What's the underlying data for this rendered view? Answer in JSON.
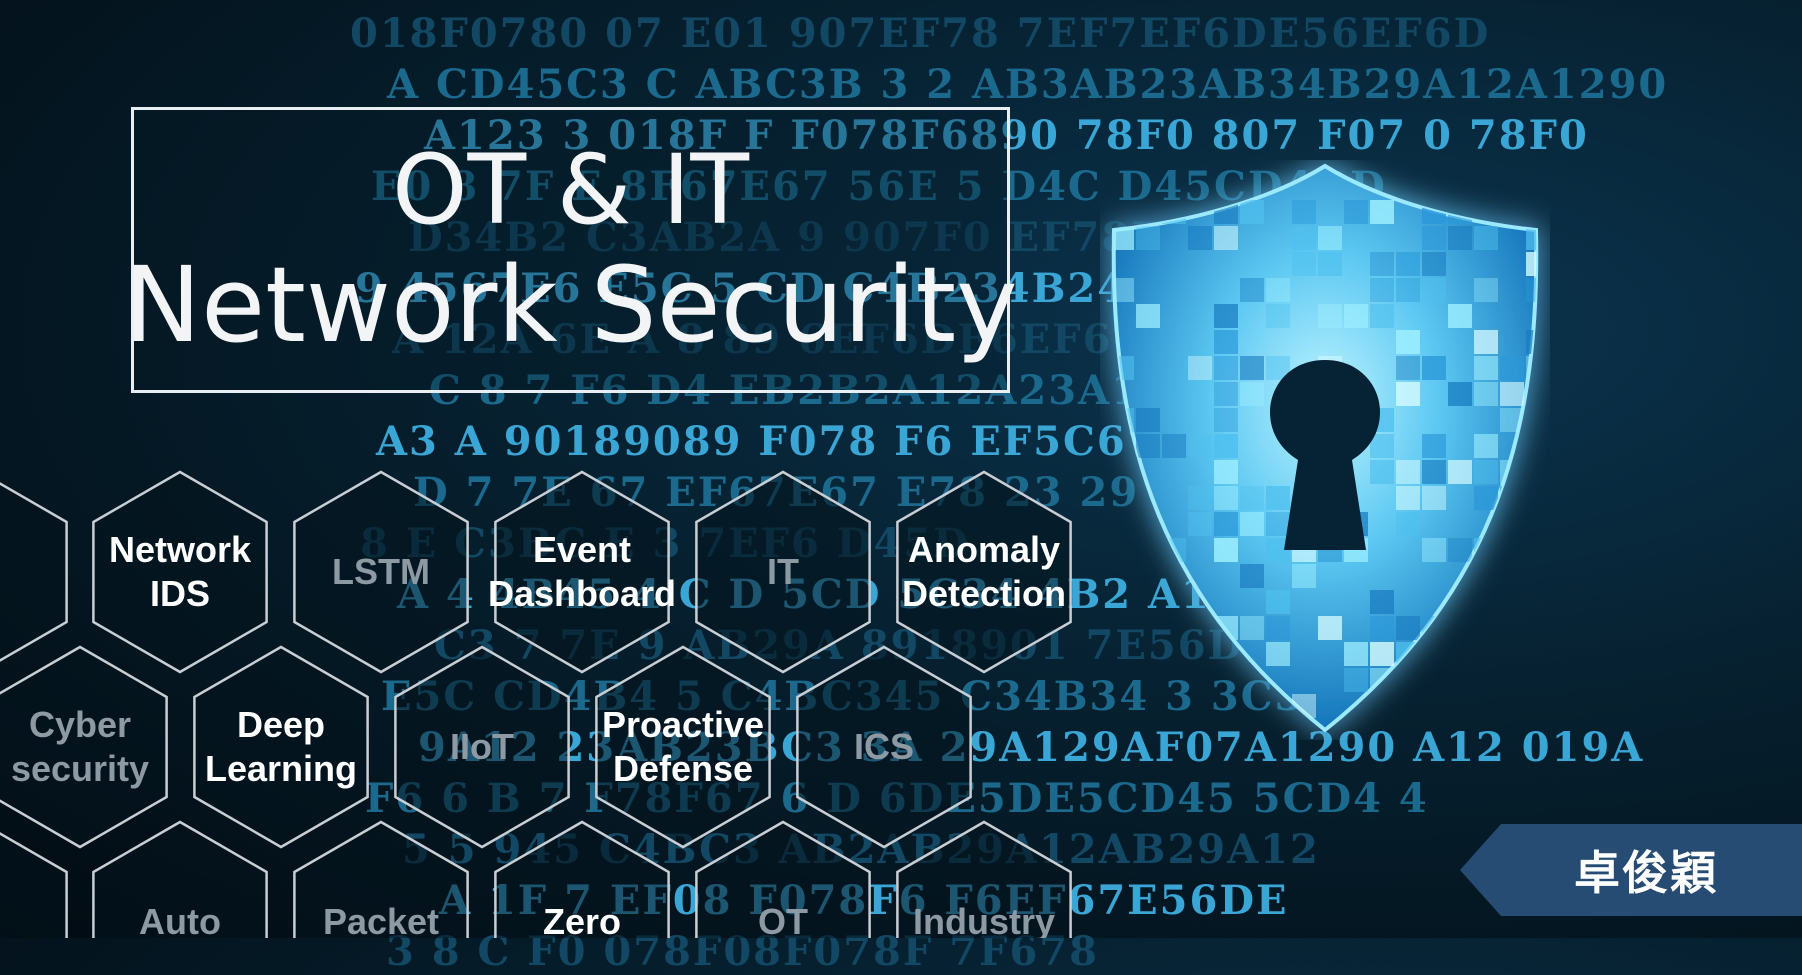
{
  "title": {
    "line1": "OT & IT",
    "line2": "Network Security"
  },
  "honeycomb": {
    "cells": [
      {
        "label": "Network\nIDS",
        "style": "active"
      },
      {
        "label": "LSTM",
        "style": "muted"
      },
      {
        "label": "Event\nDashboard",
        "style": "active"
      },
      {
        "label": "IT",
        "style": "muted"
      },
      {
        "label": "Anomaly\nDetection",
        "style": "active"
      },
      {
        "label": "Cyber\nsecurity",
        "style": "muted"
      },
      {
        "label": "Deep\nLearning",
        "style": "active"
      },
      {
        "label": "IIoT",
        "style": "muted"
      },
      {
        "label": "Proactive\nDefense",
        "style": "active"
      },
      {
        "label": "ICS",
        "style": "muted"
      },
      {
        "label": "Auto",
        "style": "muted"
      },
      {
        "label": "Packet",
        "style": "muted"
      },
      {
        "label": "Zero",
        "style": "active"
      },
      {
        "label": "OT",
        "style": "muted"
      },
      {
        "label": "Industry",
        "style": "muted"
      }
    ]
  },
  "background_code": [
    "018F0780  07  E01  907EF78  7EF7EF6DE56EF6D",
    "A  CD45C3  C  ABC3B  3  2  AB3AB23AB34B29A12A1290",
    "A123  3  018F  F  F078F6890  78F0  807  F07  0  78F0",
    "E0  8  7F  E  8F67E67  56E  5  D4C  D45CD4BD",
    "D34B2  C3AB2A  9  907F0  EF78F67EF7  E",
    "9  4567E6  E5C  5  CD  C4B234B24B  4BC34",
    "A  12A  6E  A  8  89  6EF6DE6EF67E5  18F07F",
    "C  8  7  F6  D4  EB2B2A12A23A1",
    "A3  A  90189089  F078  F6  EF5C67EF67C",
    "D  7  7E  67  EF67E67  E78  23  29  07",
    "8  E  C3BC  E  3  7EF6  D45D",
    "A  4  4B45  4  C  D  5CD  5C34  4B2  A12AB2",
    "C3  7  7E  9  AB29A  8918901  7E56D56DE",
    "E5C  CD4B4  5  C4BC345  C34B34  3  3C34",
    "9A12  23AB23BC3  3A  29A129AF07A1290  A12  019A",
    "F6  6  B  7  F78F67  6  D  6DE5DE5CD45  5CD4  4",
    "5  5  945  C4BC3  AB2AB29A12AB29A12",
    "A  1F  7  EF08  F078F6  F6EF67E56DE",
    "3  8  C  F0  078F08F078F  7F678"
  ],
  "author": "卓俊穎",
  "colors": {
    "background": "#06202f",
    "code_text": "#1b6a8e",
    "shield_light": "#7fe3ff",
    "shield_dark": "#0f7fc6",
    "name_tag": "#264c73",
    "title_text": "#f2f4f6"
  }
}
